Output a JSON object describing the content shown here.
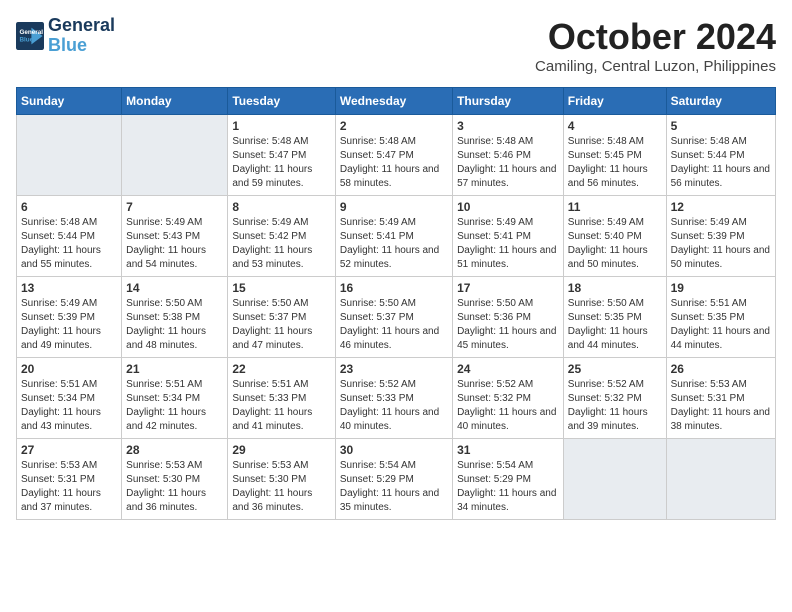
{
  "header": {
    "logo_line1": "General",
    "logo_line2": "Blue",
    "month": "October 2024",
    "location": "Camiling, Central Luzon, Philippines"
  },
  "days_of_week": [
    "Sunday",
    "Monday",
    "Tuesday",
    "Wednesday",
    "Thursday",
    "Friday",
    "Saturday"
  ],
  "weeks": [
    [
      {
        "day": "",
        "empty": true
      },
      {
        "day": "",
        "empty": true
      },
      {
        "day": "1",
        "sunrise": "5:48 AM",
        "sunset": "5:47 PM",
        "daylight": "11 hours and 59 minutes."
      },
      {
        "day": "2",
        "sunrise": "5:48 AM",
        "sunset": "5:47 PM",
        "daylight": "11 hours and 58 minutes."
      },
      {
        "day": "3",
        "sunrise": "5:48 AM",
        "sunset": "5:46 PM",
        "daylight": "11 hours and 57 minutes."
      },
      {
        "day": "4",
        "sunrise": "5:48 AM",
        "sunset": "5:45 PM",
        "daylight": "11 hours and 56 minutes."
      },
      {
        "day": "5",
        "sunrise": "5:48 AM",
        "sunset": "5:44 PM",
        "daylight": "11 hours and 56 minutes."
      }
    ],
    [
      {
        "day": "6",
        "sunrise": "5:48 AM",
        "sunset": "5:44 PM",
        "daylight": "11 hours and 55 minutes."
      },
      {
        "day": "7",
        "sunrise": "5:49 AM",
        "sunset": "5:43 PM",
        "daylight": "11 hours and 54 minutes."
      },
      {
        "day": "8",
        "sunrise": "5:49 AM",
        "sunset": "5:42 PM",
        "daylight": "11 hours and 53 minutes."
      },
      {
        "day": "9",
        "sunrise": "5:49 AM",
        "sunset": "5:41 PM",
        "daylight": "11 hours and 52 minutes."
      },
      {
        "day": "10",
        "sunrise": "5:49 AM",
        "sunset": "5:41 PM",
        "daylight": "11 hours and 51 minutes."
      },
      {
        "day": "11",
        "sunrise": "5:49 AM",
        "sunset": "5:40 PM",
        "daylight": "11 hours and 50 minutes."
      },
      {
        "day": "12",
        "sunrise": "5:49 AM",
        "sunset": "5:39 PM",
        "daylight": "11 hours and 50 minutes."
      }
    ],
    [
      {
        "day": "13",
        "sunrise": "5:49 AM",
        "sunset": "5:39 PM",
        "daylight": "11 hours and 49 minutes."
      },
      {
        "day": "14",
        "sunrise": "5:50 AM",
        "sunset": "5:38 PM",
        "daylight": "11 hours and 48 minutes."
      },
      {
        "day": "15",
        "sunrise": "5:50 AM",
        "sunset": "5:37 PM",
        "daylight": "11 hours and 47 minutes."
      },
      {
        "day": "16",
        "sunrise": "5:50 AM",
        "sunset": "5:37 PM",
        "daylight": "11 hours and 46 minutes."
      },
      {
        "day": "17",
        "sunrise": "5:50 AM",
        "sunset": "5:36 PM",
        "daylight": "11 hours and 45 minutes."
      },
      {
        "day": "18",
        "sunrise": "5:50 AM",
        "sunset": "5:35 PM",
        "daylight": "11 hours and 44 minutes."
      },
      {
        "day": "19",
        "sunrise": "5:51 AM",
        "sunset": "5:35 PM",
        "daylight": "11 hours and 44 minutes."
      }
    ],
    [
      {
        "day": "20",
        "sunrise": "5:51 AM",
        "sunset": "5:34 PM",
        "daylight": "11 hours and 43 minutes."
      },
      {
        "day": "21",
        "sunrise": "5:51 AM",
        "sunset": "5:34 PM",
        "daylight": "11 hours and 42 minutes."
      },
      {
        "day": "22",
        "sunrise": "5:51 AM",
        "sunset": "5:33 PM",
        "daylight": "11 hours and 41 minutes."
      },
      {
        "day": "23",
        "sunrise": "5:52 AM",
        "sunset": "5:33 PM",
        "daylight": "11 hours and 40 minutes."
      },
      {
        "day": "24",
        "sunrise": "5:52 AM",
        "sunset": "5:32 PM",
        "daylight": "11 hours and 40 minutes."
      },
      {
        "day": "25",
        "sunrise": "5:52 AM",
        "sunset": "5:32 PM",
        "daylight": "11 hours and 39 minutes."
      },
      {
        "day": "26",
        "sunrise": "5:53 AM",
        "sunset": "5:31 PM",
        "daylight": "11 hours and 38 minutes."
      }
    ],
    [
      {
        "day": "27",
        "sunrise": "5:53 AM",
        "sunset": "5:31 PM",
        "daylight": "11 hours and 37 minutes."
      },
      {
        "day": "28",
        "sunrise": "5:53 AM",
        "sunset": "5:30 PM",
        "daylight": "11 hours and 36 minutes."
      },
      {
        "day": "29",
        "sunrise": "5:53 AM",
        "sunset": "5:30 PM",
        "daylight": "11 hours and 36 minutes."
      },
      {
        "day": "30",
        "sunrise": "5:54 AM",
        "sunset": "5:29 PM",
        "daylight": "11 hours and 35 minutes."
      },
      {
        "day": "31",
        "sunrise": "5:54 AM",
        "sunset": "5:29 PM",
        "daylight": "11 hours and 34 minutes."
      },
      {
        "day": "",
        "empty": true
      },
      {
        "day": "",
        "empty": true
      }
    ]
  ],
  "labels": {
    "sunrise_prefix": "Sunrise: ",
    "sunset_prefix": "Sunset: ",
    "daylight_prefix": "Daylight: "
  }
}
